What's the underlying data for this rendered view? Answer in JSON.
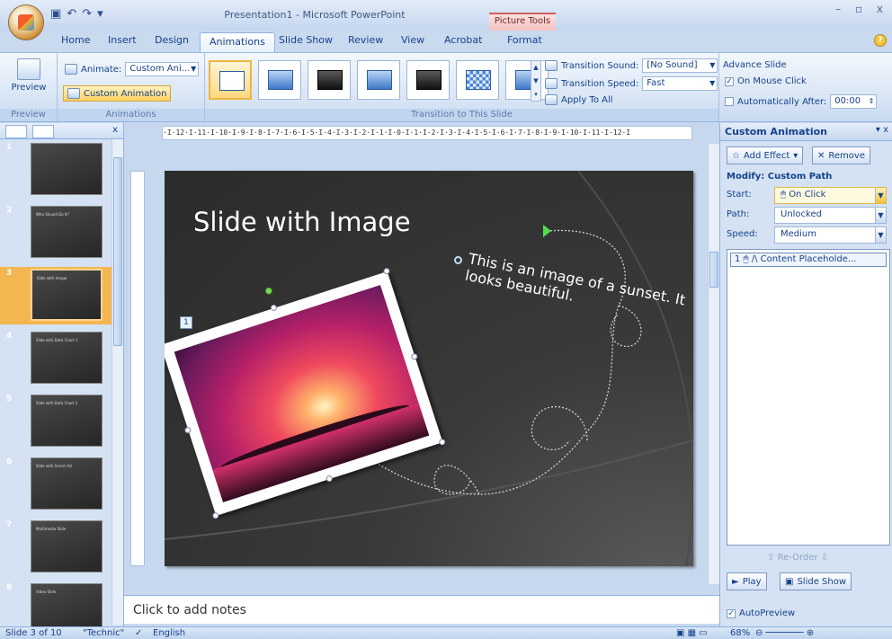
{
  "window": {
    "title": "Presentation1 - Microsoft PowerPoint",
    "contextual_tab": "Picture Tools",
    "controls": "– ▫ x"
  },
  "tabs": [
    "Home",
    "Insert",
    "Design",
    "Animations",
    "Slide Show",
    "Review",
    "View",
    "Acrobat",
    "Format"
  ],
  "active_tab": "Animations",
  "ribbon": {
    "preview": {
      "button": "Preview",
      "group": "Preview"
    },
    "animations": {
      "animate_label": "Animate:",
      "animate_value": "Custom Ani...",
      "custom_animation": "Custom Animation",
      "group": "Animations"
    },
    "transition": {
      "sound_label": "Transition Sound:",
      "sound_value": "[No Sound]",
      "speed_label": "Transition Speed:",
      "speed_value": "Fast",
      "apply_all": "Apply To All",
      "group": "Transition to This Slide"
    },
    "advance": {
      "title": "Advance Slide",
      "on_mouse_click": "On Mouse Click",
      "automatically_after": "Automatically After:",
      "time": "00:00"
    }
  },
  "slides_pane": {
    "thumbnails": [
      {
        "num": "1",
        "title": ""
      },
      {
        "num": "2",
        "title": "Who Should Do It?"
      },
      {
        "num": "3",
        "title": "Slide with Image"
      },
      {
        "num": "4",
        "title": "Slide with Data Chart 1"
      },
      {
        "num": "5",
        "title": "Slide with Data Chart 2"
      },
      {
        "num": "6",
        "title": "Slide with Smart Art"
      },
      {
        "num": "7",
        "title": "Multimedia Slide"
      },
      {
        "num": "8",
        "title": "Video Slide"
      }
    ],
    "active_index": 2
  },
  "ruler": "·I·12·I·11·I·10·I·9·I·8·I·7·I·6·I·5·I·4·I·3·I·2·I·1·I·0·I·1·I·2·I·3·I·4·I·5·I·6·I·7·I·8·I·9·I·10·I·11·I·12·I",
  "slide": {
    "title": "Slide with Image",
    "body": "This is an image of a sunset. It looks beautiful.",
    "anim_tag": "1"
  },
  "notes_placeholder": "Click to add notes",
  "task_pane": {
    "title": "Custom Animation",
    "add_effect": "Add Effect",
    "remove": "Remove",
    "modify": "Modify: Custom Path",
    "start_label": "Start:",
    "start_value": "On Click",
    "path_label": "Path:",
    "path_value": "Unlocked",
    "speed_label": "Speed:",
    "speed_value": "Medium",
    "list_item": "1 🖱 /\\ Content Placeholde...",
    "reorder": "Re-Order",
    "play": "Play",
    "slide_show": "Slide Show",
    "autopreview": "AutoPreview"
  },
  "status": {
    "slide_info": "Slide 3 of 10",
    "theme": "\"Technic\"",
    "language": "English",
    "zoom": "68%"
  },
  "colors": {
    "ribbon_bg": "#dbe7f6",
    "accent_orange": "#f4b650",
    "slide_bg": "#2b2b2b",
    "motion_start": "#4fe04f"
  }
}
